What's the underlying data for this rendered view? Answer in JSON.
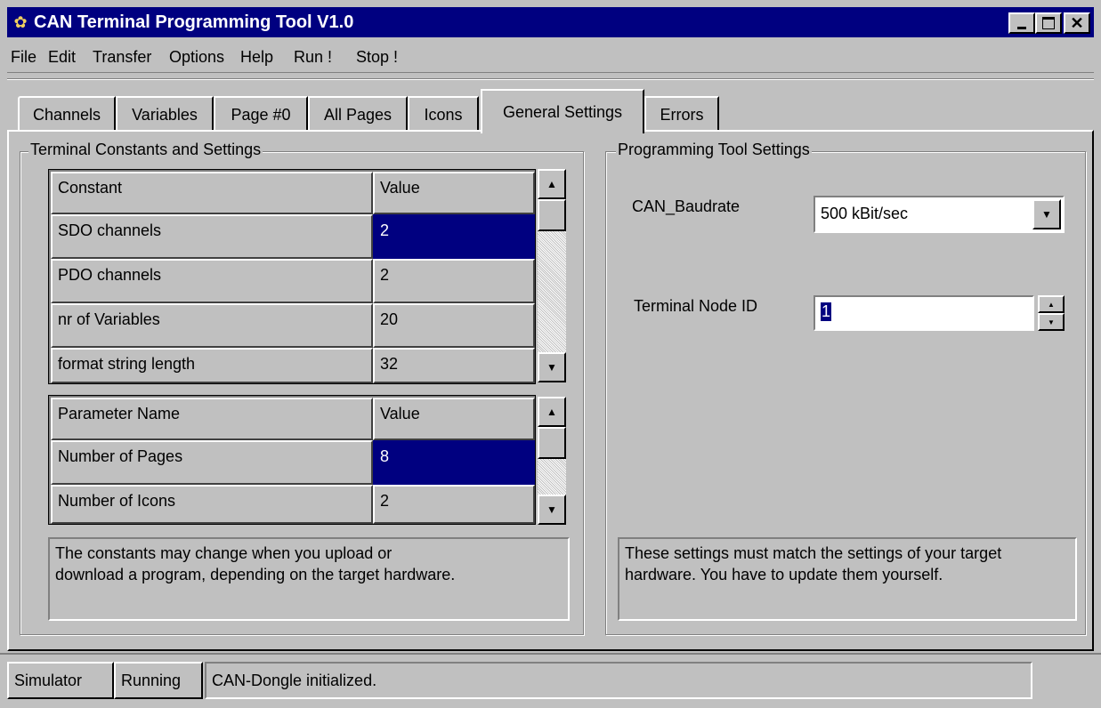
{
  "window": {
    "title": "CAN Terminal Programming Tool V1.0",
    "icon": "app-icon",
    "controls": [
      "minimize-icon",
      "maximize-icon",
      "close-icon"
    ]
  },
  "menu": {
    "file": "File",
    "edit": "Edit",
    "transfer": "Transfer",
    "options": "Options",
    "help": "Help",
    "run": "Run !",
    "stop": "Stop !"
  },
  "tabs": [
    {
      "label": "Channels"
    },
    {
      "label": "Variables"
    },
    {
      "label": "Page #0"
    },
    {
      "label": "All Pages"
    },
    {
      "label": "Icons"
    },
    {
      "label": "General Settings",
      "active": true
    },
    {
      "label": "Errors"
    }
  ],
  "terminal": {
    "group_label": "Terminal Constants and Settings",
    "constants_table": {
      "headers": [
        "Constant",
        "Value"
      ],
      "rows": [
        [
          "SDO channels",
          "2"
        ],
        [
          "PDO channels",
          "2"
        ],
        [
          "nr of Variables",
          "20"
        ],
        [
          "format string length",
          "32"
        ]
      ]
    },
    "params_table": {
      "headers": [
        "Parameter Name",
        "Value"
      ],
      "rows": [
        [
          "Number of Pages",
          "8"
        ],
        [
          "Number of Icons",
          "2"
        ]
      ]
    },
    "info_line1": "The constants may change when you upload or",
    "info_line2": "download a program, depending on the target hardware."
  },
  "programming": {
    "group_label": "Programming Tool Settings",
    "baudrate_label": "CAN_Baudrate",
    "baudrate_value": "500 kBit/sec",
    "node_id_label": "Terminal Node ID",
    "node_id_value": "1",
    "info_line1": "These settings must match the settings of your target",
    "info_line2": "hardware.  You have to update them yourself."
  },
  "status": {
    "mode": "Simulator",
    "state": "Running",
    "message": "CAN-Dongle initialized."
  },
  "colors": {
    "titlebar": "#000080",
    "face": "#c0c0c0",
    "selection": "#000080"
  }
}
